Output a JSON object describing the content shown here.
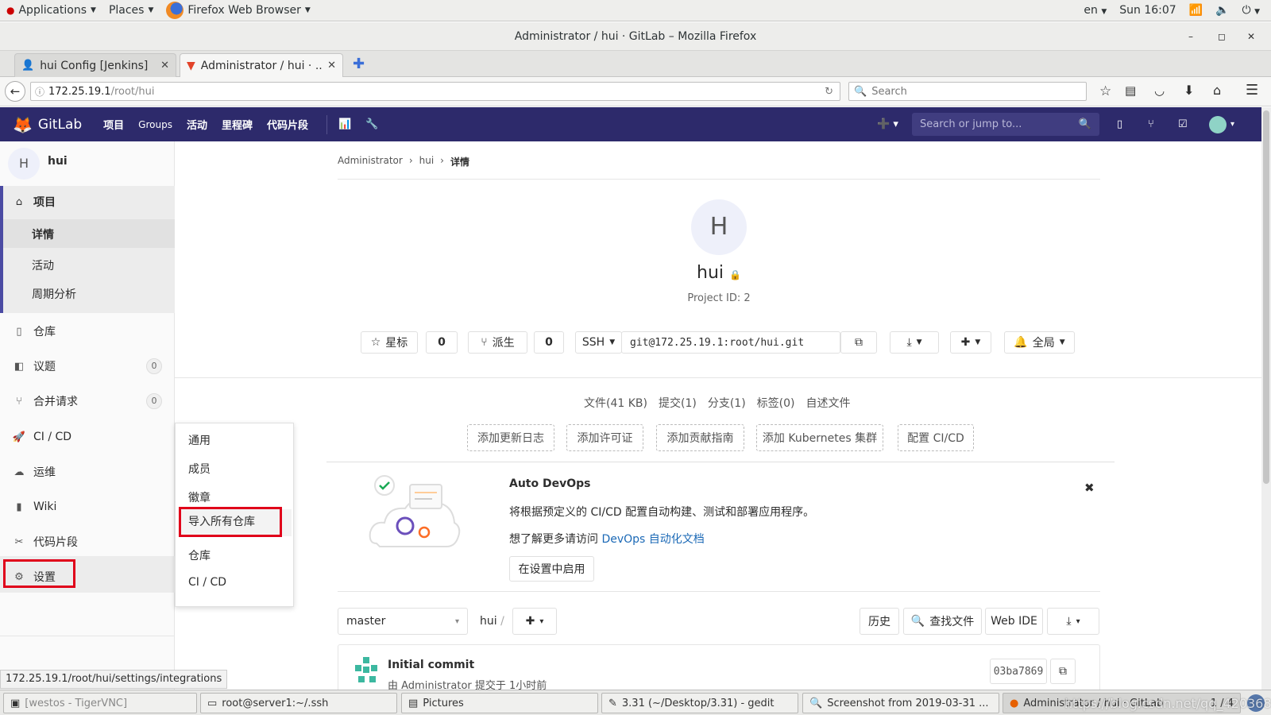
{
  "topbar": {
    "applications": "Applications",
    "places": "Places",
    "browser": "Firefox Web Browser",
    "lang": "en",
    "clock": "Sun 16:07"
  },
  "window": {
    "title": "Administrator / hui · GitLab – Mozilla Firefox"
  },
  "tabs": [
    {
      "label": "hui Config [Jenkins]"
    },
    {
      "label": "Administrator / hui · ..."
    }
  ],
  "nav": {
    "url_host": "172.25.19.1",
    "url_path": "/root/hui",
    "search_placeholder": "Search"
  },
  "gitlab_header": {
    "brand": "GitLab",
    "nav": [
      "项目",
      "Groups",
      "活动",
      "里程碑",
      "代码片段"
    ],
    "search_placeholder": "Search or jump to..."
  },
  "sidebar": {
    "project_avatar": "H",
    "project_name": "hui",
    "project_section": "项目",
    "sub_items": [
      "详情",
      "活动",
      "周期分析"
    ],
    "items": [
      {
        "label": "仓库",
        "icon": "book-icon"
      },
      {
        "label": "议题",
        "icon": "issues-icon",
        "count": "0"
      },
      {
        "label": "合并请求",
        "icon": "merge-request-icon",
        "count": "0"
      },
      {
        "label": "CI / CD",
        "icon": "rocket-icon"
      },
      {
        "label": "运维",
        "icon": "cloud-gear-icon"
      },
      {
        "label": "Wiki",
        "icon": "wiki-icon"
      },
      {
        "label": "代码片段",
        "icon": "scissors-icon"
      },
      {
        "label": "设置",
        "icon": "gear-icon"
      }
    ]
  },
  "flyout": {
    "items": [
      "通用",
      "成员",
      "徽章",
      "导入所有仓库",
      "仓库",
      "CI / CD"
    ]
  },
  "breadcrumb": [
    "Administrator",
    "hui",
    "详情"
  ],
  "project": {
    "avatar": "H",
    "name": "hui",
    "id_text": "Project ID: 2"
  },
  "actions": {
    "star": "星标",
    "star_count": "0",
    "fork": "派生",
    "fork_count": "0",
    "protocol": "SSH",
    "clone_url": "git@172.25.19.1:root/hui.git",
    "notify": "全局"
  },
  "stats": [
    "文件(41 KB)",
    "提交(1)",
    "分支(1)",
    "标签(0)",
    "自述文件"
  ],
  "quick_add": [
    "添加更新日志",
    "添加许可证",
    "添加贡献指南",
    "添加 Kubernetes 集群",
    "配置 CI/CD"
  ],
  "devops": {
    "title": "Auto DevOps",
    "description": "将根据预定义的 CI/CD 配置自动构建、测试和部署应用程序。",
    "more_prefix": "想了解更多请访问",
    "link": "DevOps 自动化文档",
    "button": "在设置中启用"
  },
  "repo": {
    "branch": "master",
    "path": "hui",
    "history": "历史",
    "find_file": "查找文件",
    "web_ide": "Web IDE"
  },
  "commit": {
    "title": "Initial commit",
    "meta": "由 Administrator 提交于 1小时前",
    "sha": "03ba7869"
  },
  "status_url": "172.25.19.1/root/hui/settings/integrations",
  "taskbar": [
    "[westos - TigerVNC]",
    "root@server1:~/.ssh",
    "Pictures",
    "3.31 (~/Desktop/3.31) - gedit",
    "Screenshot from 2019-03-31 ...",
    "Administrator / hui · GitLab ..."
  ],
  "taskbar_pager": "1 / 4",
  "watermark": "https://blog.csdn.net/qq_42036824",
  "colors": {
    "gitlab_header": "#2d2a6b",
    "highlight_box": "#e0001a",
    "link": "#1b69b6"
  }
}
